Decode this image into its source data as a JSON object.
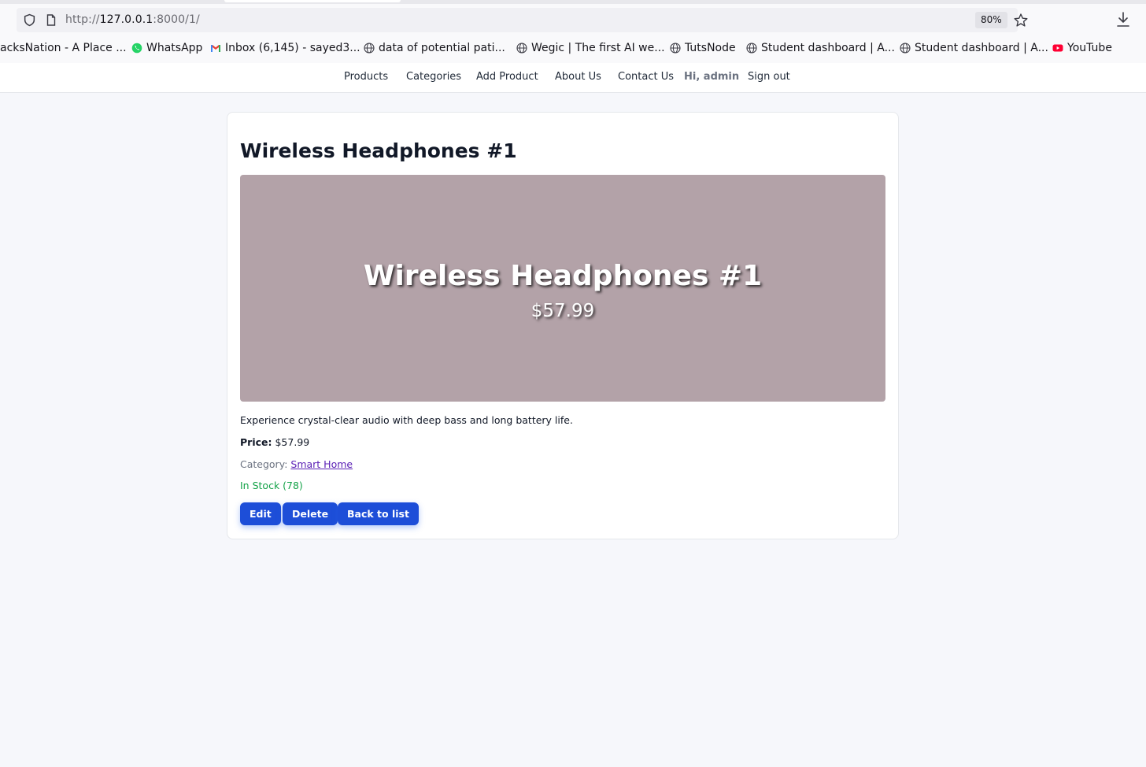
{
  "browser": {
    "url_prefix": "http://",
    "url_host": "127.0.0.1",
    "url_suffix": ":8000/1/",
    "zoom": "80%",
    "bookmarks": [
      {
        "label": "acksNation - A Place ...",
        "icon": "none"
      },
      {
        "label": "WhatsApp",
        "icon": "whatsapp-icon"
      },
      {
        "label": "Inbox (6,145) - sayed3...",
        "icon": "gmail-icon"
      },
      {
        "label": "data of potential pati...",
        "icon": "globe-icon"
      },
      {
        "label": "Wegic | The first AI we...",
        "icon": "globe-icon"
      },
      {
        "label": "TutsNode",
        "icon": "globe-icon"
      },
      {
        "label": "Student dashboard | A...",
        "icon": "globe-icon"
      },
      {
        "label": "Student dashboard | A...",
        "icon": "globe-icon"
      },
      {
        "label": "YouTube",
        "icon": "youtube-icon"
      }
    ]
  },
  "nav": {
    "products": "Products",
    "categories": "Categories",
    "add_product": "Add Product",
    "about": "About Us",
    "contact": "Contact Us",
    "greeting": "Hi, admin",
    "signout": "Sign out"
  },
  "product": {
    "title": "Wireless Headphones #1",
    "image_title": "Wireless Headphones #1",
    "image_price": "$57.99",
    "description": "Experience crystal-clear audio with deep bass and long battery life.",
    "price_label": "Price:",
    "price_value": "$57.99",
    "category_label": "Category:",
    "category_value": "Smart Home",
    "stock": "In Stock (78)"
  },
  "actions": {
    "edit": "Edit",
    "delete": "Delete",
    "back": "Back to list"
  },
  "colors": {
    "primary": "#1d4ed8",
    "hero_bg": "#b3a2a8",
    "stock_green": "#16a34a",
    "category_link": "#5b21b6"
  }
}
